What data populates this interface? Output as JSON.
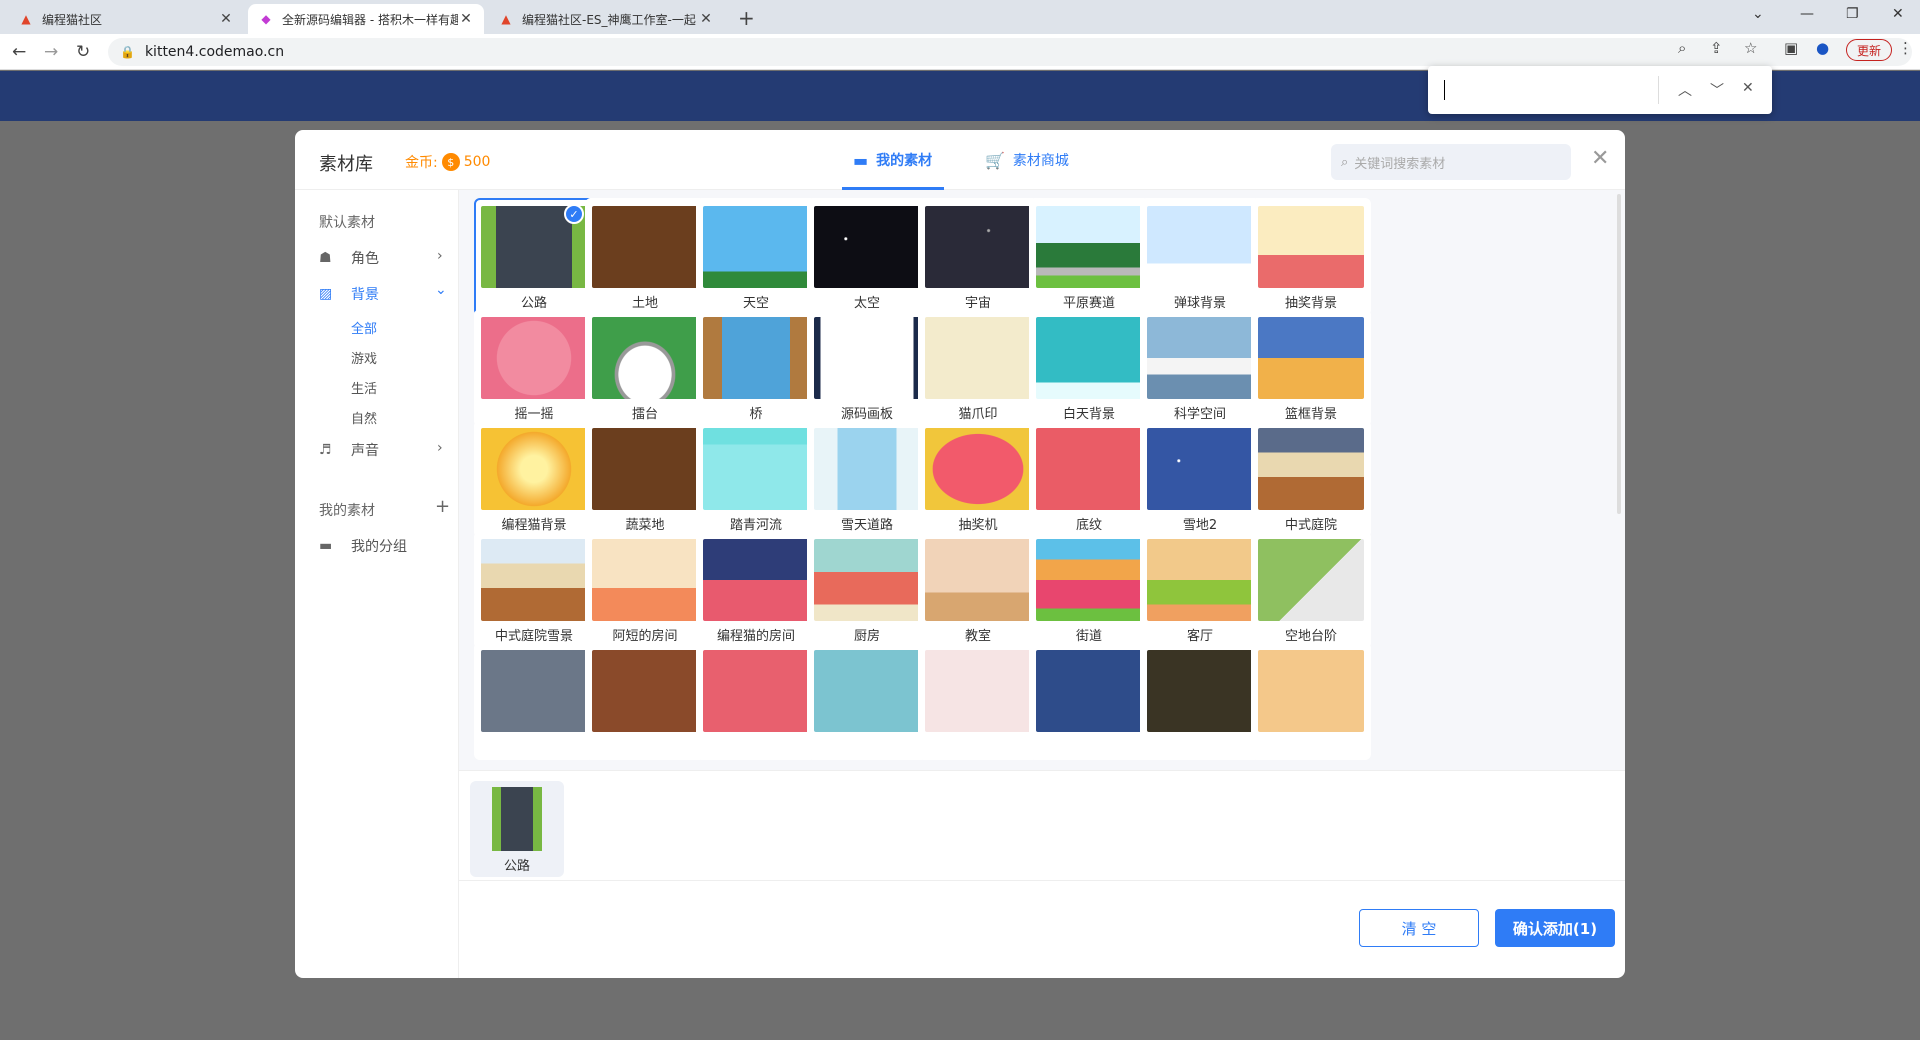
{
  "browser": {
    "tabs": [
      {
        "title": "编程猫社区",
        "active": false
      },
      {
        "title": "全新源码编辑器 - 搭积木一样有趣",
        "active": true
      },
      {
        "title": "编程猫社区-ES_神鹰工作室-一起",
        "active": false
      }
    ],
    "url": "kitten4.codemao.cn",
    "update_label": "更新"
  },
  "dialog": {
    "title": "素材库",
    "coins_label": "金币:",
    "coins_icon": "$",
    "coins_value": "500",
    "tabs": [
      {
        "label": "我的素材"
      },
      {
        "label": "素材商城"
      }
    ],
    "search_placeholder": "关键词搜索素材",
    "sidebar": {
      "section_default": "默认素材",
      "role": "角色",
      "background": "背景",
      "sub": [
        "全部",
        "游戏",
        "生活",
        "自然"
      ],
      "sound": "声音",
      "my_assets": "我的素材",
      "add": "+",
      "my_groups": "我的分组"
    },
    "assets": [
      {
        "name": "公路",
        "selected": true
      },
      {
        "name": "土地"
      },
      {
        "name": "天空"
      },
      {
        "name": "太空"
      },
      {
        "name": "宇宙"
      },
      {
        "name": "平原赛道"
      },
      {
        "name": "弹球背景"
      },
      {
        "name": "抽奖背景"
      },
      {
        "name": "摇一摇"
      },
      {
        "name": "擂台"
      },
      {
        "name": "桥"
      },
      {
        "name": "源码画板"
      },
      {
        "name": "猫爪印"
      },
      {
        "name": "白天背景"
      },
      {
        "name": "科学空间"
      },
      {
        "name": "篮框背景"
      },
      {
        "name": "编程猫背景"
      },
      {
        "name": "蔬菜地"
      },
      {
        "name": "踏青河流"
      },
      {
        "name": "雪天道路"
      },
      {
        "name": "抽奖机"
      },
      {
        "name": "底纹"
      },
      {
        "name": "雪地2"
      },
      {
        "name": "中式庭院"
      },
      {
        "name": "中式庭院雪景"
      },
      {
        "name": "阿短的房间"
      },
      {
        "name": "编程猫的房间"
      },
      {
        "name": "厨房"
      },
      {
        "name": "教室"
      },
      {
        "name": "街道"
      },
      {
        "name": "客厅"
      },
      {
        "name": "空地台阶"
      }
    ],
    "tray_item": {
      "name": "公路"
    },
    "clear_label": "清 空",
    "confirm_label": "确认添加(1)"
  }
}
